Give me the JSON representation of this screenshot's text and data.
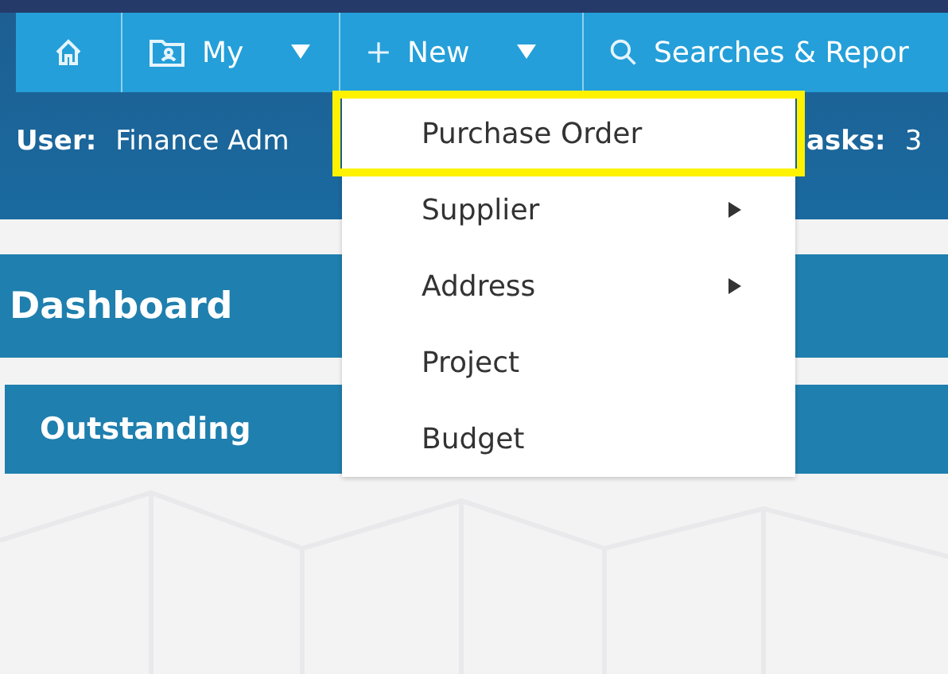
{
  "nav": [
    {
      "kind": "home"
    },
    {
      "kind": "folder",
      "label": "My",
      "caret": true
    },
    {
      "kind": "plus",
      "label": "New",
      "caret": true
    },
    {
      "kind": "search",
      "label": "Searches & Repor",
      "caret": false
    }
  ],
  "header": {
    "user_label": "User:",
    "user_value": "Finance Adm",
    "tasks_label": "asks:",
    "tasks_value": "3"
  },
  "page_title": "Dashboard",
  "section_title": "Outstanding",
  "menu": [
    {
      "label": "Purchase Order",
      "submenu": false,
      "selected": true
    },
    {
      "label": "Supplier",
      "submenu": true,
      "selected": false
    },
    {
      "label": "Address",
      "submenu": true,
      "selected": false
    },
    {
      "label": "Project",
      "submenu": false,
      "selected": false
    },
    {
      "label": "Budget",
      "submenu": false,
      "selected": false
    }
  ]
}
